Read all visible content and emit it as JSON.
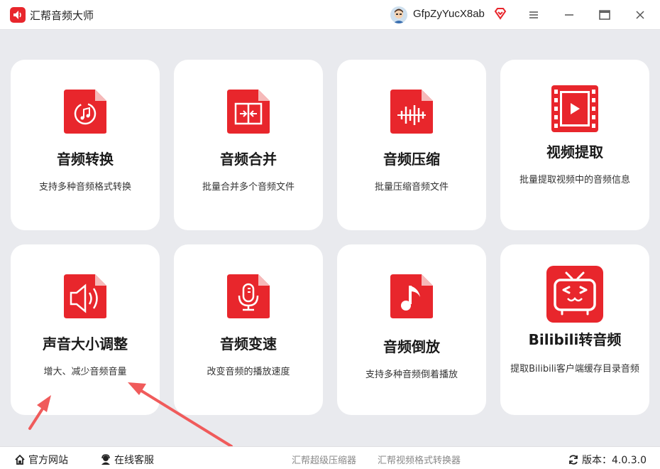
{
  "app": {
    "title": "汇帮音频大师",
    "username": "GfpZyYucX8ab"
  },
  "colors": {
    "accent": "#e8262c",
    "card_bg": "#ffffff",
    "page_bg": "#e9eaee",
    "arrow": "#f05b5b"
  },
  "window_controls": [
    "menu-icon",
    "minimize-icon",
    "maximize-icon",
    "close-icon"
  ],
  "tools": [
    {
      "name": "音频转换",
      "desc": "支持多种音频格式转换",
      "icon": "audio-convert-icon"
    },
    {
      "name": "音频合并",
      "desc": "批量合并多个音频文件",
      "icon": "audio-merge-icon"
    },
    {
      "name": "音频压缩",
      "desc": "批量压缩音频文件",
      "icon": "audio-compress-icon"
    },
    {
      "name": "视频提取",
      "desc": "批量提取视频中的音频信息",
      "icon": "video-extract-icon"
    },
    {
      "name": "声音大小调整",
      "desc": "增大、减少音频音量",
      "icon": "volume-adjust-icon"
    },
    {
      "name": "音频变速",
      "desc": "改变音频的播放速度",
      "icon": "microphone-icon"
    },
    {
      "name": "音频倒放",
      "desc": "支持多种音频倒着播放",
      "icon": "music-note-icon"
    },
    {
      "name": "Bilibili转音频",
      "desc": "提取Bilibili客户端缓存目录音频",
      "icon": "bilibili-tv-icon"
    }
  ],
  "footer": {
    "website": "官方网站",
    "support": "在线客服",
    "link1": "汇帮超级压缩器",
    "link2": "汇帮视频格式转换器",
    "version": "版本：4.0.3.0"
  }
}
